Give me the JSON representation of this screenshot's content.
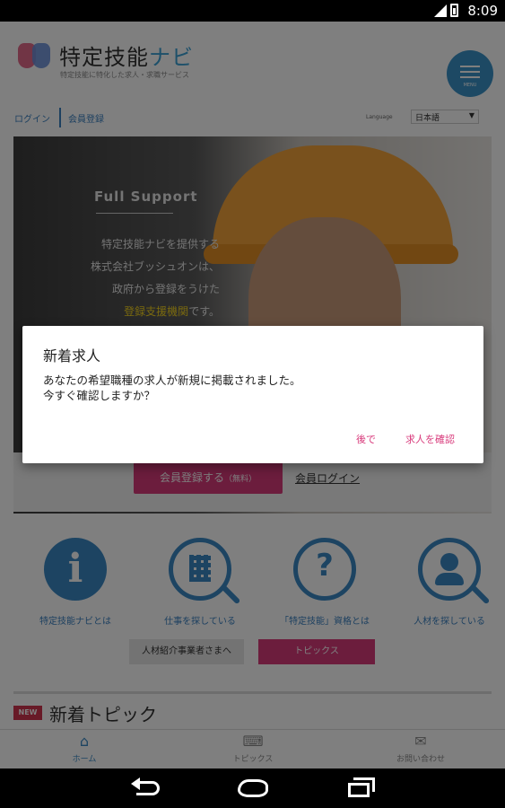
{
  "status_bar": {
    "time": "8:09"
  },
  "header": {
    "title_main": "特定技能",
    "title_accent": "ナビ",
    "subtitle": "特定技能に特化した求人・求職サービス",
    "menu_label": "MENU"
  },
  "subnav": {
    "login": "ログイン",
    "register": "会員登録",
    "language_label": "Language",
    "language_value": "日本語"
  },
  "hero": {
    "heading": "Full Support",
    "copy_line1": "特定技能ナビを提供する",
    "copy_line2": "株式会社ブッシュオンは、",
    "copy_line3": "政府から登録をうけた",
    "copy_highlight": "登録支援機関",
    "copy_tail": "です。"
  },
  "cta": {
    "register_button": "会員登録する",
    "register_button_note": "（無料）",
    "login_link": "会員ログイン"
  },
  "features": [
    {
      "label": "特定技能ナビとは",
      "icon": "info-icon"
    },
    {
      "label": "仕事を探している",
      "icon": "building-search-icon"
    },
    {
      "label": "「特定技能」資格とは",
      "icon": "question-icon"
    },
    {
      "label": "人材を探している",
      "icon": "person-search-icon"
    }
  ],
  "buttons": {
    "agency": "人材紹介事業者さまへ",
    "topics": "トピックス"
  },
  "topics_section": {
    "badge": "NEW",
    "title": "新着トピック"
  },
  "tabbar": {
    "items": [
      {
        "label": "ホーム",
        "icon": "home-icon"
      },
      {
        "label": "トピックス",
        "icon": "keyboard-icon"
      },
      {
        "label": "お問い合わせ",
        "icon": "mail-icon"
      }
    ]
  },
  "dialog": {
    "title": "新着求人",
    "message_line1": "あなたの希望職種の求人が新規に掲載されました。",
    "message_line2": "今すぐ確認しますか？",
    "later_button": "後で",
    "confirm_button": "求人を確認"
  },
  "colors": {
    "accent_blue": "#3a89c5",
    "accent_pink": "#d83a7b",
    "scrim": "rgba(0,0,0,0.5)"
  }
}
